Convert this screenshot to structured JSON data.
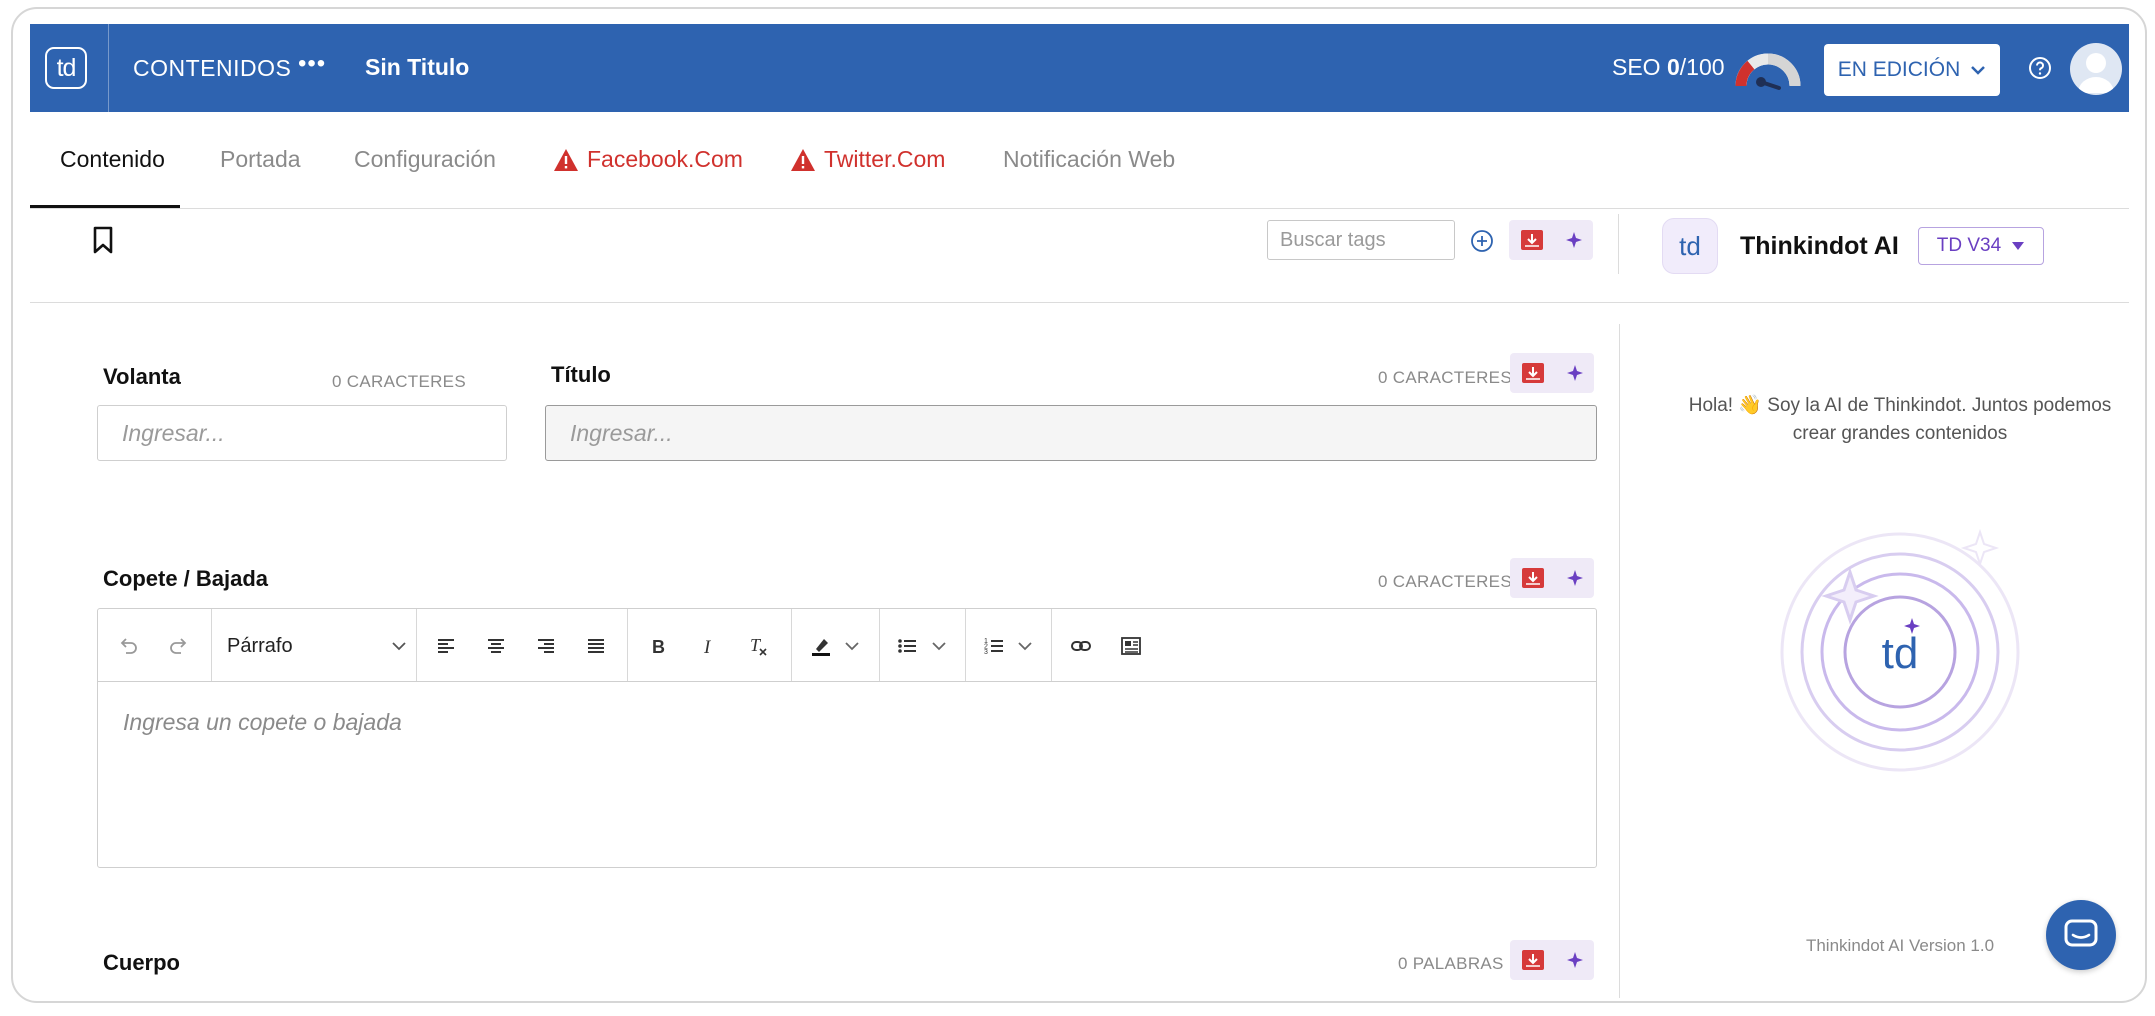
{
  "header": {
    "logo_text": "td",
    "nav_label": "CONTENIDOS",
    "more_label": "•••",
    "doc_title": "Sin Titulo",
    "seo_label": "SEO",
    "seo_score": "0",
    "seo_max": "/100",
    "status_label": "EN EDICIÓN"
  },
  "tabs": [
    {
      "label": "Contenido",
      "active": true
    },
    {
      "label": "Portada"
    },
    {
      "label": "Configuración"
    },
    {
      "label": "Facebook.Com",
      "warning": true
    },
    {
      "label": "Twitter.Com",
      "warning": true
    },
    {
      "label": "Notificación Web"
    }
  ],
  "tags": {
    "placeholder": "Buscar tags"
  },
  "ai": {
    "logo_text": "td",
    "name": "Thinkindot AI",
    "version_selector": "TD V34",
    "intro": "Hola! 👋 Soy la AI de Thinkindot. Juntos podemos crear grandes contenidos",
    "orb_text": "td",
    "footer_version": "Thinkindot AI Version 1.0"
  },
  "fields": {
    "volanta": {
      "label": "Volanta",
      "count": "0 CARACTERES",
      "placeholder": "Ingresar..."
    },
    "titulo": {
      "label": "Título",
      "count": "0 CARACTERES",
      "placeholder": "Ingresar..."
    },
    "copete": {
      "label": "Copete / Bajada",
      "count": "0 CARACTERES",
      "placeholder": "Ingresa un copete o bajada",
      "block_format": "Párrafo"
    },
    "cuerpo": {
      "label": "Cuerpo",
      "count": "0 PALABRAS"
    }
  },
  "colors": {
    "brand": "#2e63b0",
    "warning": "#d0312d",
    "ai_accent": "#6a3fc2"
  }
}
